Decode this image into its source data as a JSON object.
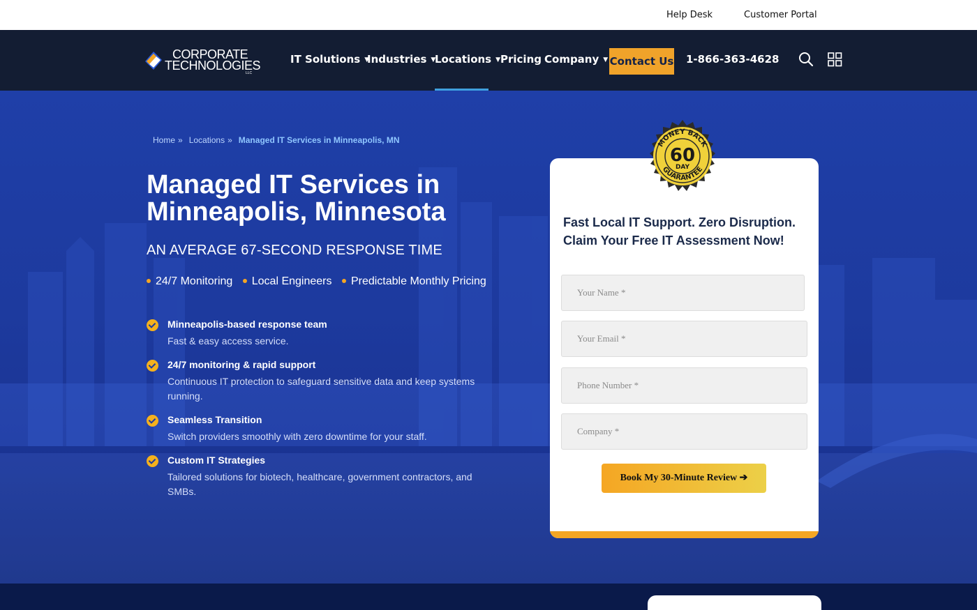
{
  "topbar": {
    "help_desk": "Help Desk",
    "customer_portal": "Customer Portal"
  },
  "nav": {
    "logo_line1": "CORPORATE",
    "logo_line2": "TECHNOLOGIES",
    "logo_llc": "LLC",
    "items": [
      {
        "label": "IT Solutions",
        "caret": "▼"
      },
      {
        "label": "Industries",
        "caret": "▼"
      },
      {
        "label": "Locations",
        "caret": "▼",
        "active": true
      },
      {
        "label": "Pricing"
      },
      {
        "label": "Company",
        "caret": "▼"
      }
    ],
    "contact_label": "Contact Us",
    "phone": "1-866-363-4628",
    "icons": [
      "search-icon",
      "grid-menu-icon"
    ]
  },
  "breadcrumb": {
    "home": "Home",
    "locations": "Locations",
    "separator": "»",
    "current": "Managed IT Services in Minneapolis, MN"
  },
  "hero": {
    "title_line1": "Managed IT Services in",
    "title_line2": "Minneapolis, Minnesota",
    "subtitle": "AN AVERAGE 67-SECOND RESPONSE TIME",
    "bullets": [
      "24/7 Monitoring",
      "Local Engineers",
      "Predictable Monthly Pricing"
    ],
    "features": [
      {
        "title": "Minneapolis-based response team",
        "desc": "Fast & easy access service."
      },
      {
        "title": "24/7 monitoring & rapid support",
        "desc": "Continuous IT protection to safeguard sensitive data and keep systems running."
      },
      {
        "title": "Seamless Transition",
        "desc": "Switch providers smoothly with zero downtime for your staff."
      },
      {
        "title": "Custom IT Strategies",
        "desc": "Tailored solutions for biotech, healthcare, government contractors, and SMBs."
      }
    ]
  },
  "form": {
    "badge_top": "MONEY BACK",
    "badge_number": "60",
    "badge_day": "DAY",
    "badge_bottom": "GUARANTEE",
    "title_line1": "Fast Local IT Support. Zero Disruption.",
    "title_line2": "Claim Your Free IT Assessment Now!",
    "name_placeholder": "Your Name *",
    "email_placeholder": "Your Email *",
    "phone_placeholder": "Phone Number *",
    "company_placeholder": "Company *",
    "submit_label": "Book My 30-Minute Review ➔"
  },
  "colors": {
    "nav_bg": "#131d33",
    "accent": "#f0a32a",
    "hero_blue": "#1d3a9e",
    "link_blue": "#3fa0e0"
  }
}
